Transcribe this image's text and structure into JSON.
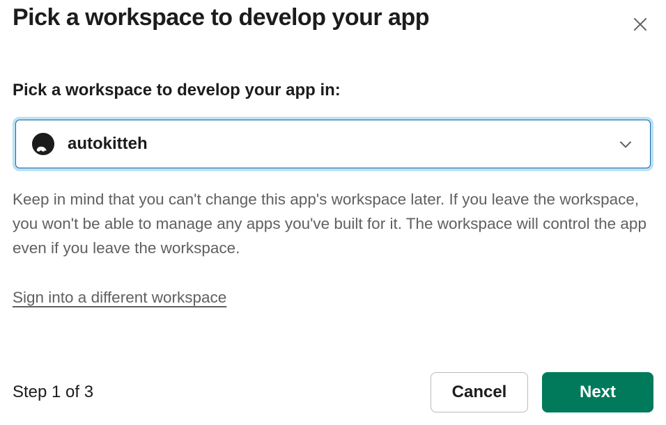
{
  "modal": {
    "title": "Pick a workspace to develop your app",
    "field_label": "Pick a workspace to develop your app in:",
    "selected_workspace": "autokitteh",
    "help_text": "Keep in mind that you can't change this app's workspace later. If you leave the workspace, you won't be able to manage any apps you've built for it. The workspace will control the app even if you leave the workspace.",
    "different_workspace_link": "Sign into a different workspace",
    "step_indicator": "Step 1 of 3",
    "cancel_label": "Cancel",
    "next_label": "Next"
  }
}
